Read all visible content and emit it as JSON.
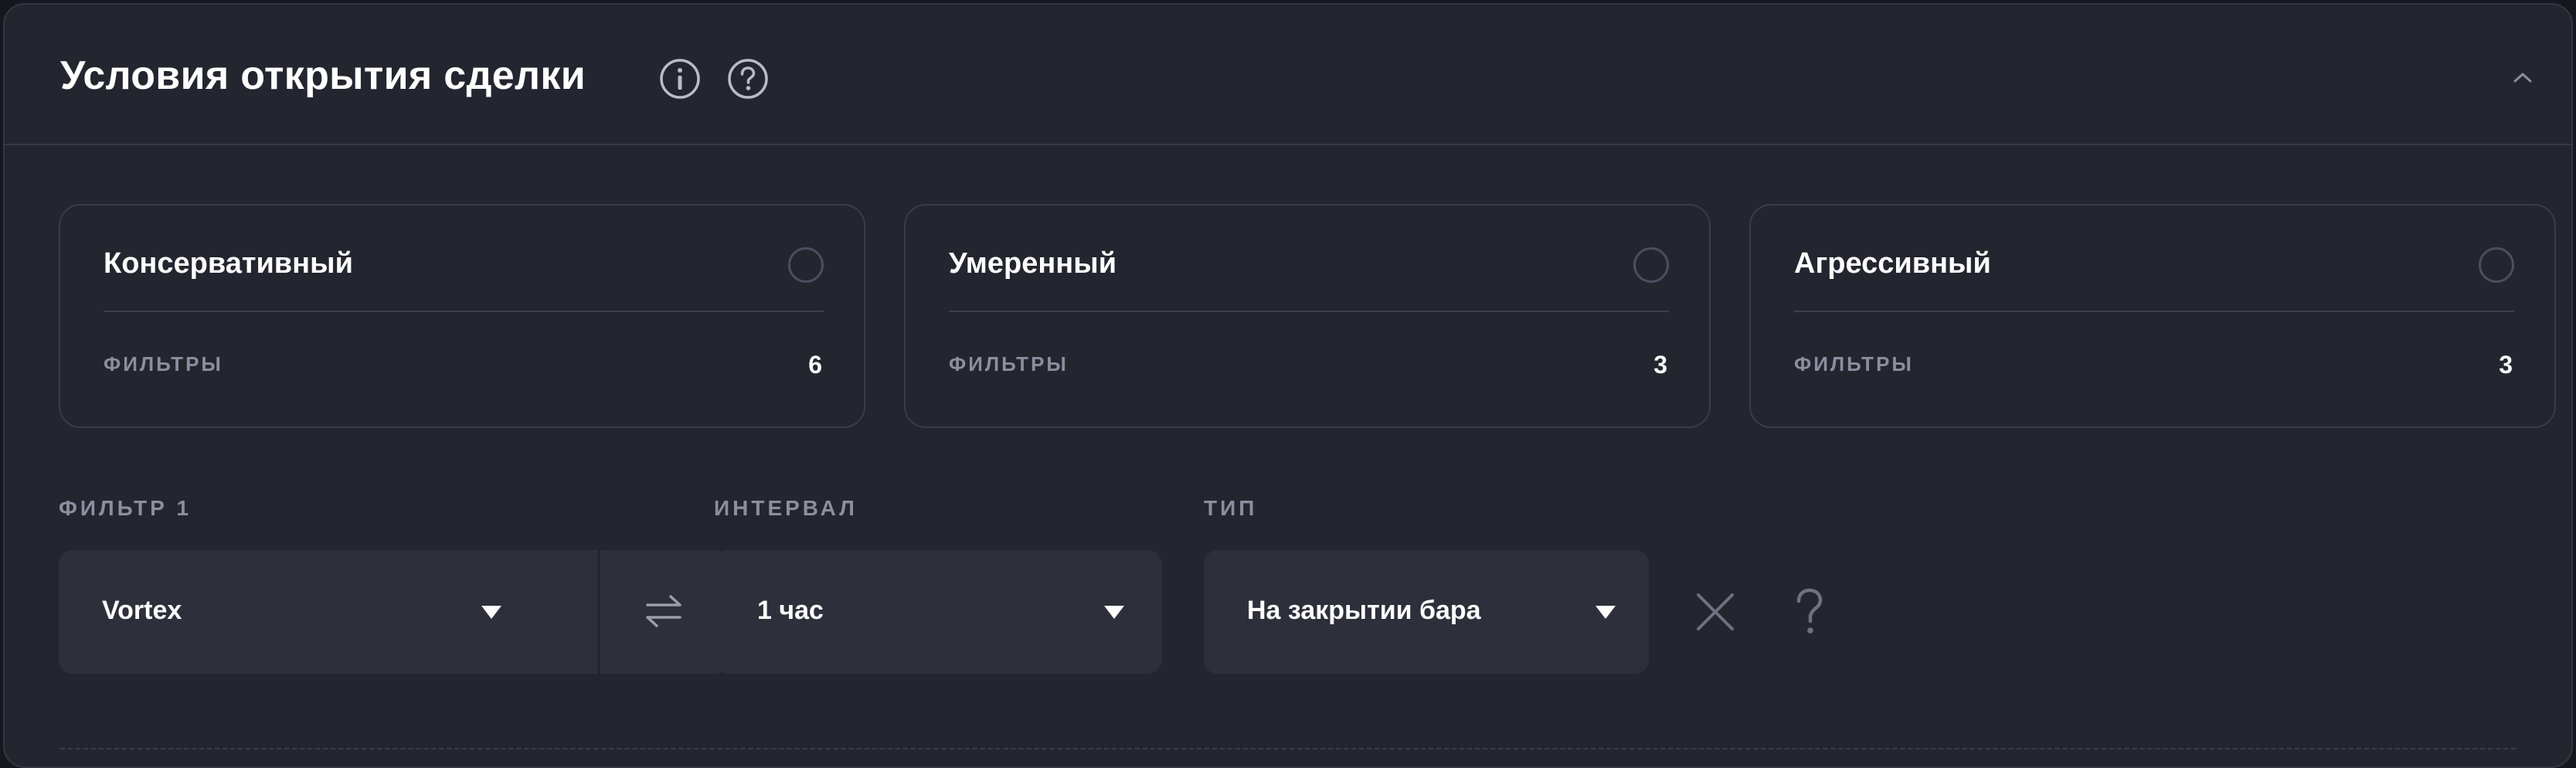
{
  "header": {
    "title": "Условия открытия сделки",
    "info_icon": "info-icon",
    "help_icon": "question-circle-icon",
    "collapse_icon": "chevron-up-icon"
  },
  "modes": [
    {
      "name": "Консервативный",
      "filters_label": "ФИЛЬТРЫ",
      "filters_count": "6",
      "selected": false
    },
    {
      "name": "Умеренный",
      "filters_label": "ФИЛЬТРЫ",
      "filters_count": "3",
      "selected": false
    },
    {
      "name": "Агрессивный",
      "filters_label": "ФИЛЬТРЫ",
      "filters_count": "3",
      "selected": false
    }
  ],
  "filter_row": {
    "filter": {
      "label": "ФИЛЬТР 1",
      "value": "Vortex",
      "swap_icon": "swap-arrows-icon"
    },
    "interval": {
      "label": "ИНТЕРВАЛ",
      "value": "1 час"
    },
    "type": {
      "label": "ТИП",
      "value": "На закрытии бара"
    },
    "remove_icon": "close-icon",
    "help_icon": "question-mark-icon"
  },
  "colors": {
    "background": "#17181d",
    "panel": "#23252f",
    "select_bg": "#2d2f3a",
    "text_primary": "#ffffff",
    "text_muted": "#8b8f9d",
    "border": "#3a3d49"
  }
}
